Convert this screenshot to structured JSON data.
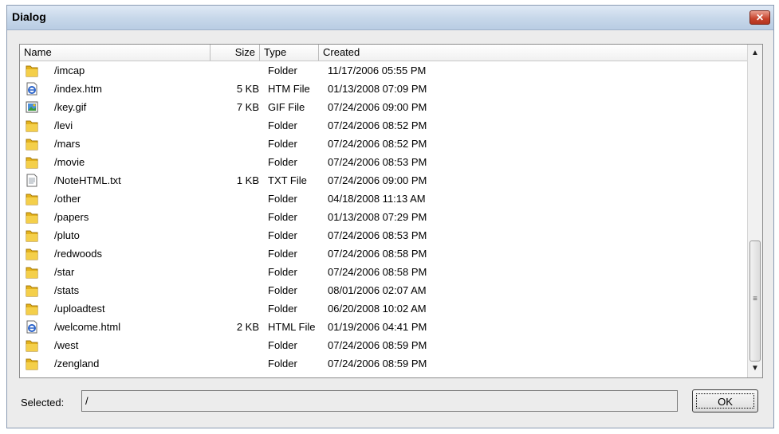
{
  "window": {
    "title": "Dialog",
    "close_label": "✕"
  },
  "columns": {
    "name": "Name",
    "size": "Size",
    "type": "Type",
    "created": "Created"
  },
  "files": [
    {
      "name": "/imcap",
      "size": "",
      "type": "Folder",
      "created": "11/17/2006 05:55 PM",
      "icon": "folder-icon"
    },
    {
      "name": "/index.htm",
      "size": "5 KB",
      "type": "HTM File",
      "created": "01/13/2008 07:09 PM",
      "icon": "ie-document-icon"
    },
    {
      "name": "/key.gif",
      "size": "7 KB",
      "type": "GIF File",
      "created": "07/24/2006 09:00 PM",
      "icon": "image-file-icon"
    },
    {
      "name": "/levi",
      "size": "",
      "type": "Folder",
      "created": "07/24/2006 08:52 PM",
      "icon": "folder-icon"
    },
    {
      "name": "/mars",
      "size": "",
      "type": "Folder",
      "created": "07/24/2006 08:52 PM",
      "icon": "folder-icon"
    },
    {
      "name": "/movie",
      "size": "",
      "type": "Folder",
      "created": "07/24/2006 08:53 PM",
      "icon": "folder-icon"
    },
    {
      "name": "/NoteHTML.txt",
      "size": "1 KB",
      "type": "TXT File",
      "created": "07/24/2006 09:00 PM",
      "icon": "text-file-icon"
    },
    {
      "name": "/other",
      "size": "",
      "type": "Folder",
      "created": "04/18/2008 11:13 AM",
      "icon": "folder-icon"
    },
    {
      "name": "/papers",
      "size": "",
      "type": "Folder",
      "created": "01/13/2008 07:29 PM",
      "icon": "folder-icon"
    },
    {
      "name": "/pluto",
      "size": "",
      "type": "Folder",
      "created": "07/24/2006 08:53 PM",
      "icon": "folder-icon"
    },
    {
      "name": "/redwoods",
      "size": "",
      "type": "Folder",
      "created": "07/24/2006 08:58 PM",
      "icon": "folder-icon"
    },
    {
      "name": "/star",
      "size": "",
      "type": "Folder",
      "created": "07/24/2006 08:58 PM",
      "icon": "folder-icon"
    },
    {
      "name": "/stats",
      "size": "",
      "type": "Folder",
      "created": "08/01/2006 02:07 AM",
      "icon": "folder-icon"
    },
    {
      "name": "/uploadtest",
      "size": "",
      "type": "Folder",
      "created": "06/20/2008 10:02 AM",
      "icon": "folder-icon"
    },
    {
      "name": "/welcome.html",
      "size": "2 KB",
      "type": "HTML File",
      "created": "01/19/2006 04:41 PM",
      "icon": "ie-document-icon"
    },
    {
      "name": "/west",
      "size": "",
      "type": "Folder",
      "created": "07/24/2006 08:59 PM",
      "icon": "folder-icon"
    },
    {
      "name": "/zengland",
      "size": "",
      "type": "Folder",
      "created": "07/24/2006 08:59 PM",
      "icon": "folder-icon"
    }
  ],
  "selected": {
    "label": "Selected:",
    "value": "/"
  },
  "buttons": {
    "ok": "OK"
  },
  "colors": {
    "folder": "#e3b21c",
    "titlebar": "#c8d8ea",
    "close": "#c7432c",
    "ie_blue": "#2a63c9"
  }
}
